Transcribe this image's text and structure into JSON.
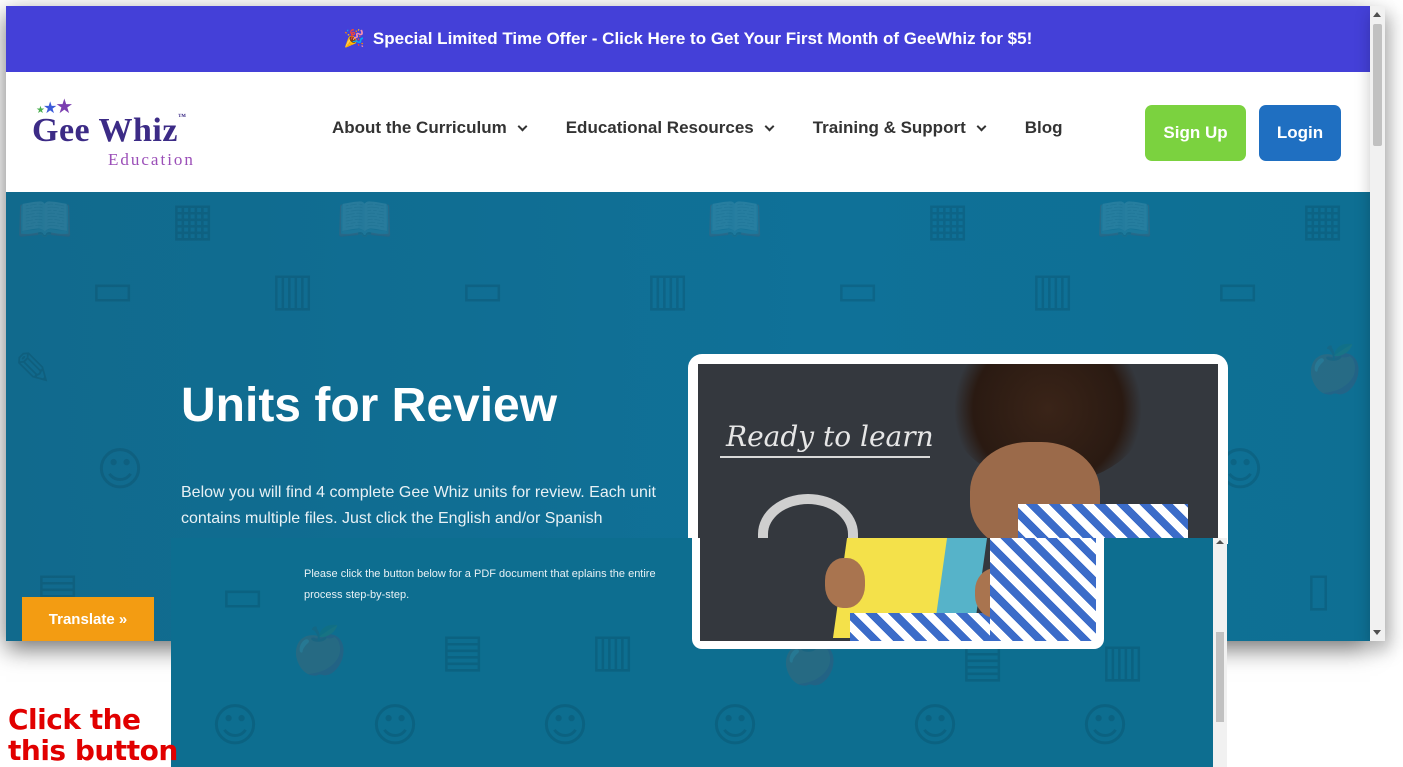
{
  "promo": {
    "icon": "party-popper-icon",
    "text": "Special Limited Time Offer - Click Here to Get Your First Month of GeeWhiz for $5!"
  },
  "logo": {
    "name": "Gee Whiz",
    "tm": "™",
    "sub": "Education"
  },
  "nav": {
    "items": [
      {
        "label": "About the Curriculum",
        "dropdown": true
      },
      {
        "label": "Educational Resources",
        "dropdown": true
      },
      {
        "label": "Training & Support",
        "dropdown": true
      },
      {
        "label": "Blog",
        "dropdown": false
      }
    ],
    "signup_label": "Sign Up",
    "login_label": "Login"
  },
  "hero": {
    "title": "Units for Review",
    "description": "Below you will find 4 complete Gee Whiz units for review. Each unit contains multiple files. Just click the English and/or Spanish",
    "photo_caption": "Ready to learn"
  },
  "second_window": {
    "pdf_note": "Please click the button below for a PDF document that eplains the entire process step-by-step."
  },
  "translate": {
    "label": "Translate »"
  },
  "callout": {
    "line1": "Click the",
    "line2": "this button"
  },
  "colors": {
    "promo_bg": "#4440d8",
    "hero_bg": "#0f7198",
    "signup": "#7bd23f",
    "login": "#1f6fc1",
    "translate": "#f39c12",
    "callout": "#e10000"
  }
}
